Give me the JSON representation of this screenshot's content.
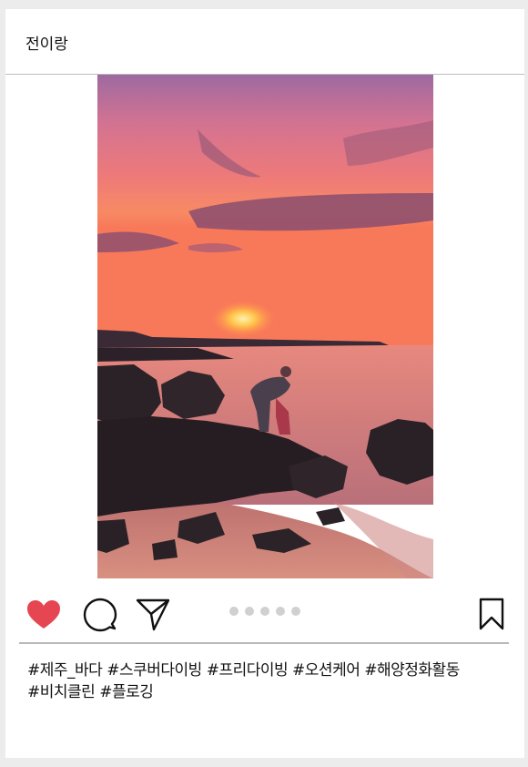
{
  "post": {
    "username": "전이랑",
    "liked": true,
    "carousel": {
      "count": 5,
      "current": 1
    },
    "caption_lines": [
      "#제주_바다 #스쿠버다이빙 #프리다이빙 #오션케어 #해양정화활동",
      "#비치클린 #플로깅"
    ]
  },
  "icons": {
    "like": "heart-icon",
    "comment": "comment-bubble-icon",
    "share": "paper-plane-icon",
    "save": "bookmark-icon"
  },
  "colors": {
    "heart": "#e64552",
    "dot": "#d0d0d0",
    "divider": "#b8b8b8"
  }
}
